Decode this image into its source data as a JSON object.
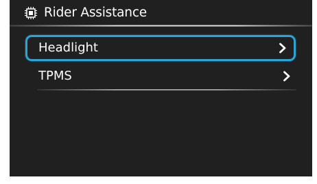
{
  "header": {
    "title": "Rider Assistance",
    "icon": "chip-icon"
  },
  "menu": {
    "items": [
      {
        "label": "Headlight",
        "selected": true,
        "icon": "chevron-right-icon"
      },
      {
        "label": "TPMS",
        "selected": false,
        "icon": "chevron-right-icon"
      }
    ]
  },
  "colors": {
    "background": "#202020",
    "highlight": "#2ba4d8",
    "text": "#ffffff"
  }
}
